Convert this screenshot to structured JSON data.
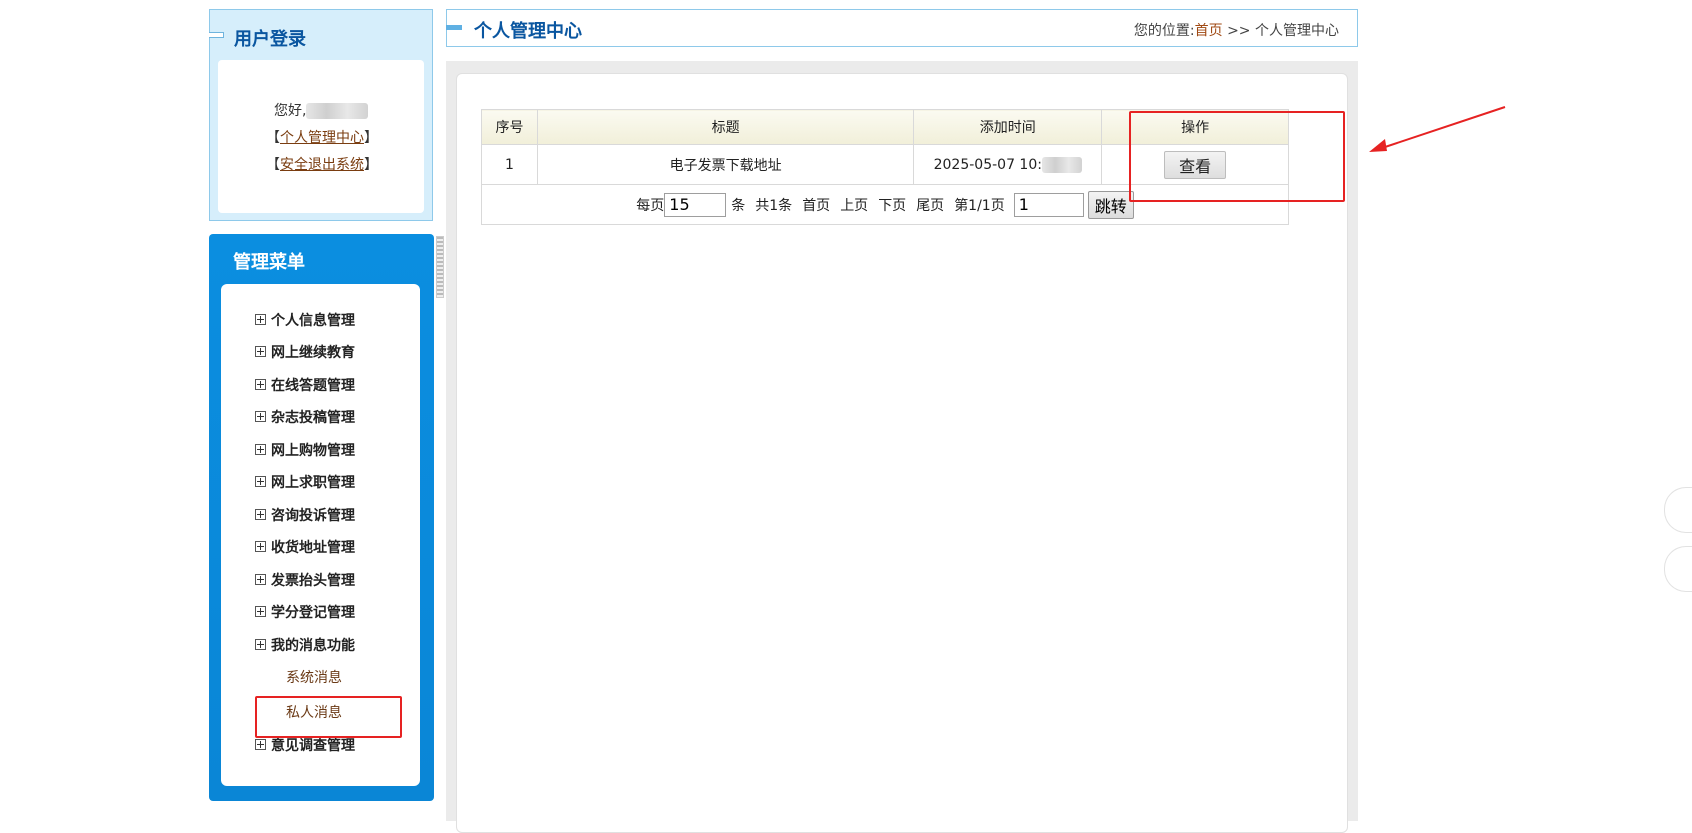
{
  "login": {
    "title": "用户登录",
    "greeting": "您好,",
    "bracket_open": "【",
    "bracket_close": "】",
    "link_center": "个人管理中心",
    "link_logout": "安全退出系统"
  },
  "menu": {
    "title": "管理菜单",
    "items": [
      {
        "label": "个人信息管理"
      },
      {
        "label": "网上继续教育"
      },
      {
        "label": "在线答题管理"
      },
      {
        "label": "杂志投稿管理"
      },
      {
        "label": "网上购物管理"
      },
      {
        "label": "网上求职管理"
      },
      {
        "label": "咨询投诉管理"
      },
      {
        "label": "收货地址管理"
      },
      {
        "label": "发票抬头管理"
      },
      {
        "label": "学分登记管理"
      },
      {
        "label": "我的消息功能"
      },
      {
        "label": "意见调查管理"
      }
    ],
    "sub_items": [
      {
        "label": "系统消息"
      },
      {
        "label": "私人消息"
      }
    ]
  },
  "header": {
    "title": "个人管理中心",
    "crumb_prefix": "您的位置:",
    "crumb_home": "首页",
    "crumb_sep": " >> ",
    "crumb_current": "个人管理中心"
  },
  "table": {
    "columns": [
      "序号",
      "标题",
      "添加时间",
      "操作"
    ],
    "rows": [
      {
        "index": "1",
        "title": "电子发票下载地址",
        "time": "2025-05-07 10:",
        "action": "查看"
      }
    ]
  },
  "pager": {
    "per_page_label": "每页",
    "per_page_value": "15",
    "unit": "条",
    "total": "共1条",
    "first": "首页",
    "prev": "上页",
    "next": "下页",
    "last": "尾页",
    "page_info": "第1/1页",
    "goto_value": "1",
    "jump": "跳转"
  },
  "colors": {
    "accent_blue": "#0a86d6",
    "title_blue": "#0a56a0",
    "annotation_red": "#e62222"
  }
}
